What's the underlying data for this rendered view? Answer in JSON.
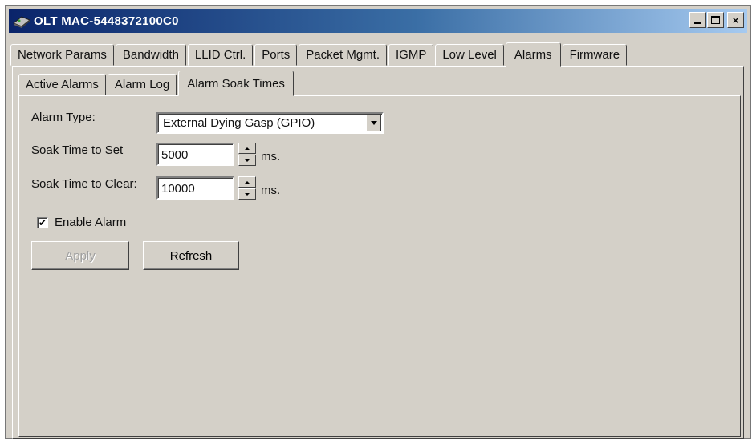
{
  "window": {
    "title": "OLT MAC-5448372100C0",
    "icon": "olt-device-icon",
    "controls": {
      "minimize": "minimize-icon",
      "maximize": "maximize-icon",
      "close": "×"
    }
  },
  "main_tabs": [
    "Network Params",
    "Bandwidth",
    "LLID Ctrl.",
    "Ports",
    "Packet Mgmt.",
    "IGMP",
    "Low Level",
    "Alarms",
    "Firmware"
  ],
  "main_tabs_active": "Alarms",
  "sub_tabs": [
    "Active Alarms",
    "Alarm Log",
    "Alarm Soak Times"
  ],
  "sub_tabs_active": "Alarm Soak Times",
  "form": {
    "alarm_type_label": "Alarm Type:",
    "alarm_type_value": "External Dying Gasp (GPIO)",
    "soak_set_label": "Soak Time to Set",
    "soak_set_value": "5000",
    "soak_set_unit": "ms.",
    "soak_clear_label": "Soak Time to Clear:",
    "soak_clear_value": "10000",
    "soak_clear_unit": "ms.",
    "enable_alarm_label": "Enable Alarm",
    "enable_alarm_checked": true,
    "check_glyph": "✔"
  },
  "buttons": {
    "apply": "Apply",
    "apply_enabled": false,
    "refresh": "Refresh"
  },
  "colors": {
    "face": "#d4d0c8",
    "title_start": "#0a246a",
    "title_end": "#a6caf0"
  }
}
